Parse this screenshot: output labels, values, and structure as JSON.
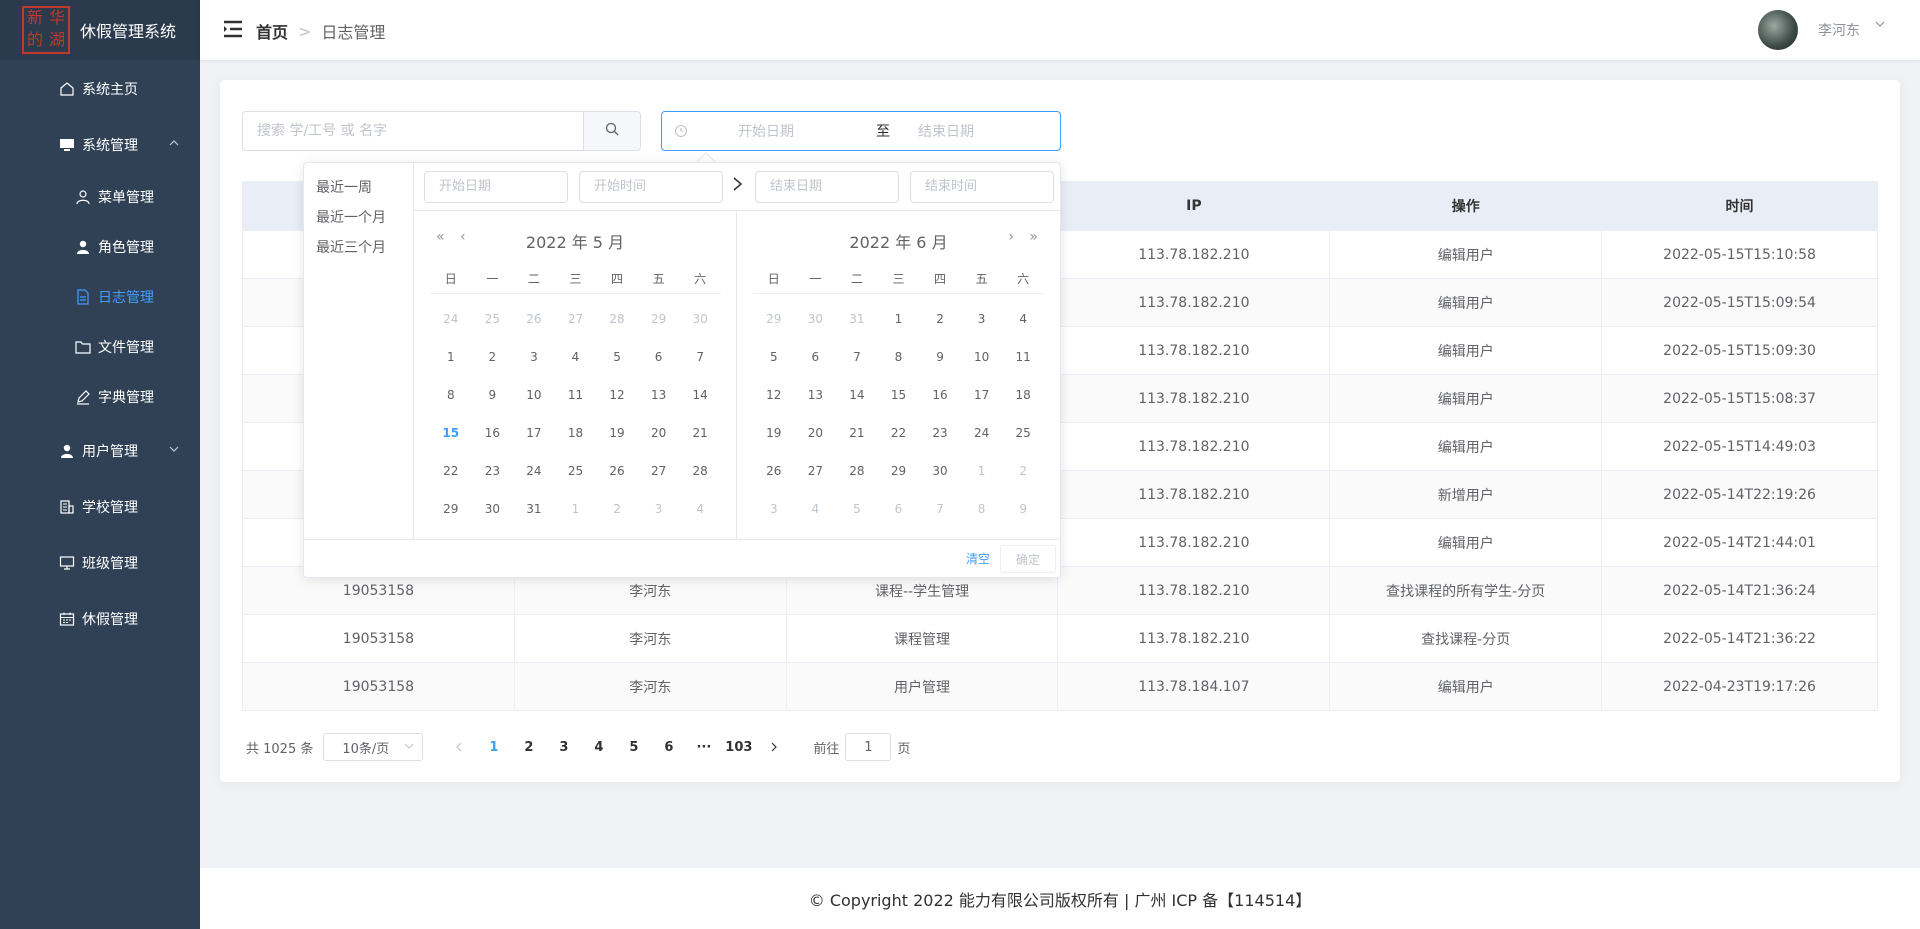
{
  "app": {
    "title": "休假管理系统",
    "logo_chars": [
      "新",
      "华",
      "的",
      "湖"
    ]
  },
  "sidebar": {
    "items": [
      {
        "label": "系统主页",
        "icon": "home-icon"
      },
      {
        "label": "系统管理",
        "icon": "monitor-icon",
        "expanded": true
      },
      {
        "label": "菜单管理",
        "icon": "user-outline-icon"
      },
      {
        "label": "角色管理",
        "icon": "user-solid-icon"
      },
      {
        "label": "日志管理",
        "icon": "document-icon",
        "active": true
      },
      {
        "label": "文件管理",
        "icon": "folder-icon"
      },
      {
        "label": "字典管理",
        "icon": "pen-icon"
      },
      {
        "label": "用户管理",
        "icon": "user-solid-icon",
        "expanded": false
      },
      {
        "label": "学校管理",
        "icon": "building-icon"
      },
      {
        "label": "班级管理",
        "icon": "monitor-icon"
      },
      {
        "label": "休假管理",
        "icon": "calendar-icon"
      }
    ],
    "active_color": "#409eff"
  },
  "header": {
    "breadcrumb_home": "首页",
    "breadcrumb_current": "日志管理",
    "username": "李河东"
  },
  "search": {
    "placeholder": "搜索 学/工号 或 名字"
  },
  "daterange": {
    "start_placeholder": "开始日期",
    "separator": "至",
    "end_placeholder": "结束日期"
  },
  "table": {
    "columns": [
      "",
      "",
      "",
      "IP",
      "操作",
      "时间"
    ],
    "rows": [
      [
        "",
        "",
        "",
        "113.78.182.210",
        "编辑用户",
        "2022-05-15T15:10:58"
      ],
      [
        "",
        "",
        "",
        "113.78.182.210",
        "编辑用户",
        "2022-05-15T15:09:54"
      ],
      [
        "",
        "",
        "",
        "113.78.182.210",
        "编辑用户",
        "2022-05-15T15:09:30"
      ],
      [
        "",
        "",
        "",
        "113.78.182.210",
        "编辑用户",
        "2022-05-15T15:08:37"
      ],
      [
        "",
        "",
        "",
        "113.78.182.210",
        "编辑用户",
        "2022-05-15T14:49:03"
      ],
      [
        "",
        "",
        "",
        "113.78.182.210",
        "新增用户",
        "2022-05-14T22:19:26"
      ],
      [
        "",
        "",
        "",
        "113.78.182.210",
        "编辑用户",
        "2022-05-14T21:44:01"
      ],
      [
        "19053158",
        "李河东",
        "课程--学生管理",
        "113.78.182.210",
        "查找课程的所有学生-分页",
        "2022-05-14T21:36:24"
      ],
      [
        "19053158",
        "李河东",
        "课程管理",
        "113.78.182.210",
        "查找课程-分页",
        "2022-05-14T21:36:22"
      ],
      [
        "19053158",
        "李河东",
        "用户管理",
        "113.78.184.107",
        "编辑用户",
        "2022-04-23T19:17:26"
      ]
    ]
  },
  "pagination": {
    "total": "共 1025 条",
    "page_size": "10条/页",
    "pages": [
      "1",
      "2",
      "3",
      "4",
      "5",
      "6",
      "···",
      "103"
    ],
    "current": "1",
    "jump_prefix": "前往",
    "jump_value": "1",
    "jump_suffix": "页"
  },
  "picker": {
    "shortcuts": [
      "最近一周",
      "最近一个月",
      "最近三个月"
    ],
    "start_date_placeholder": "开始日期",
    "start_time_placeholder": "开始时间",
    "end_date_placeholder": "结束日期",
    "end_time_placeholder": "结束时间",
    "weekdays": [
      "日",
      "一",
      "二",
      "三",
      "四",
      "五",
      "六"
    ],
    "left_title": "2022 年 5 月",
    "right_title": "2022 年 6 月",
    "left_days": [
      [
        "24",
        "25",
        "26",
        "27",
        "28",
        "29",
        "30"
      ],
      [
        "1",
        "2",
        "3",
        "4",
        "5",
        "6",
        "7"
      ],
      [
        "8",
        "9",
        "10",
        "11",
        "12",
        "13",
        "14"
      ],
      [
        "15",
        "16",
        "17",
        "18",
        "19",
        "20",
        "21"
      ],
      [
        "22",
        "23",
        "24",
        "25",
        "26",
        "27",
        "28"
      ],
      [
        "29",
        "30",
        "31",
        "1",
        "2",
        "3",
        "4"
      ]
    ],
    "right_days": [
      [
        "29",
        "30",
        "31",
        "1",
        "2",
        "3",
        "4"
      ],
      [
        "5",
        "6",
        "7",
        "8",
        "9",
        "10",
        "11"
      ],
      [
        "12",
        "13",
        "14",
        "15",
        "16",
        "17",
        "18"
      ],
      [
        "19",
        "20",
        "21",
        "22",
        "23",
        "24",
        "25"
      ],
      [
        "26",
        "27",
        "28",
        "29",
        "30",
        "1",
        "2"
      ],
      [
        "3",
        "4",
        "5",
        "6",
        "7",
        "8",
        "9"
      ]
    ],
    "today": "15",
    "clear_label": "清空",
    "confirm_label": "确定"
  },
  "footer": {
    "text": "© Copyright 2022 能力有限公司版权所有 | 广州 ICP 备【114514】"
  }
}
